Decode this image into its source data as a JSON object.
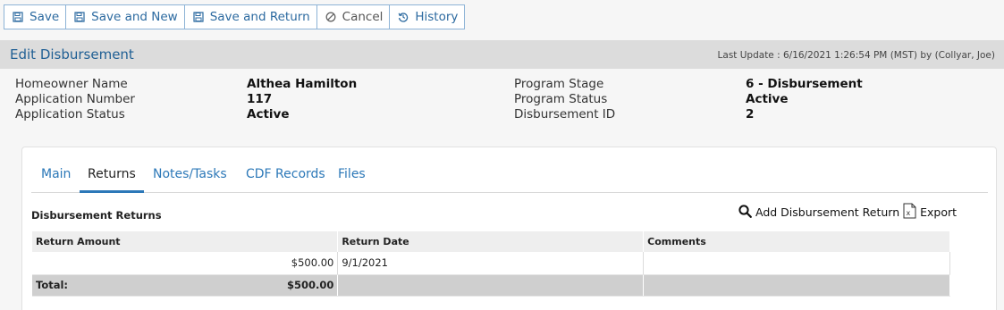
{
  "toolbar": {
    "save_label": "Save",
    "save_new_label": "Save and New",
    "save_return_label": "Save and Return",
    "cancel_label": "Cancel",
    "history_label": "History"
  },
  "header": {
    "title": "Edit Disbursement",
    "last_update": "Last Update : 6/16/2021 1:26:54 PM (MST) by (Collyar, Joe)"
  },
  "info": {
    "homeowner_label": "Homeowner Name",
    "homeowner_value": "Althea Hamilton",
    "app_number_label": "Application Number",
    "app_number_value": "117",
    "app_status_label": "Application Status",
    "app_status_value": "Active",
    "program_stage_label": "Program Stage",
    "program_stage_value": "6 - Disbursement",
    "program_status_label": "Program Status",
    "program_status_value": "Active",
    "disbursement_id_label": "Disbursement ID",
    "disbursement_id_value": "2"
  },
  "tabs": [
    "Main",
    "Returns",
    "Notes/Tasks",
    "CDF Records",
    "Files"
  ],
  "returns": {
    "section_title": "Disbursement Returns",
    "add_label": "Add Disbursement Return",
    "export_label": "Export",
    "columns": [
      "Return Amount",
      "Return Date",
      "Comments"
    ],
    "rows": [
      {
        "amount": "$500.00",
        "date": "9/1/2021",
        "comments": ""
      }
    ],
    "total_label": "Total:",
    "total_value": "$500.00"
  }
}
